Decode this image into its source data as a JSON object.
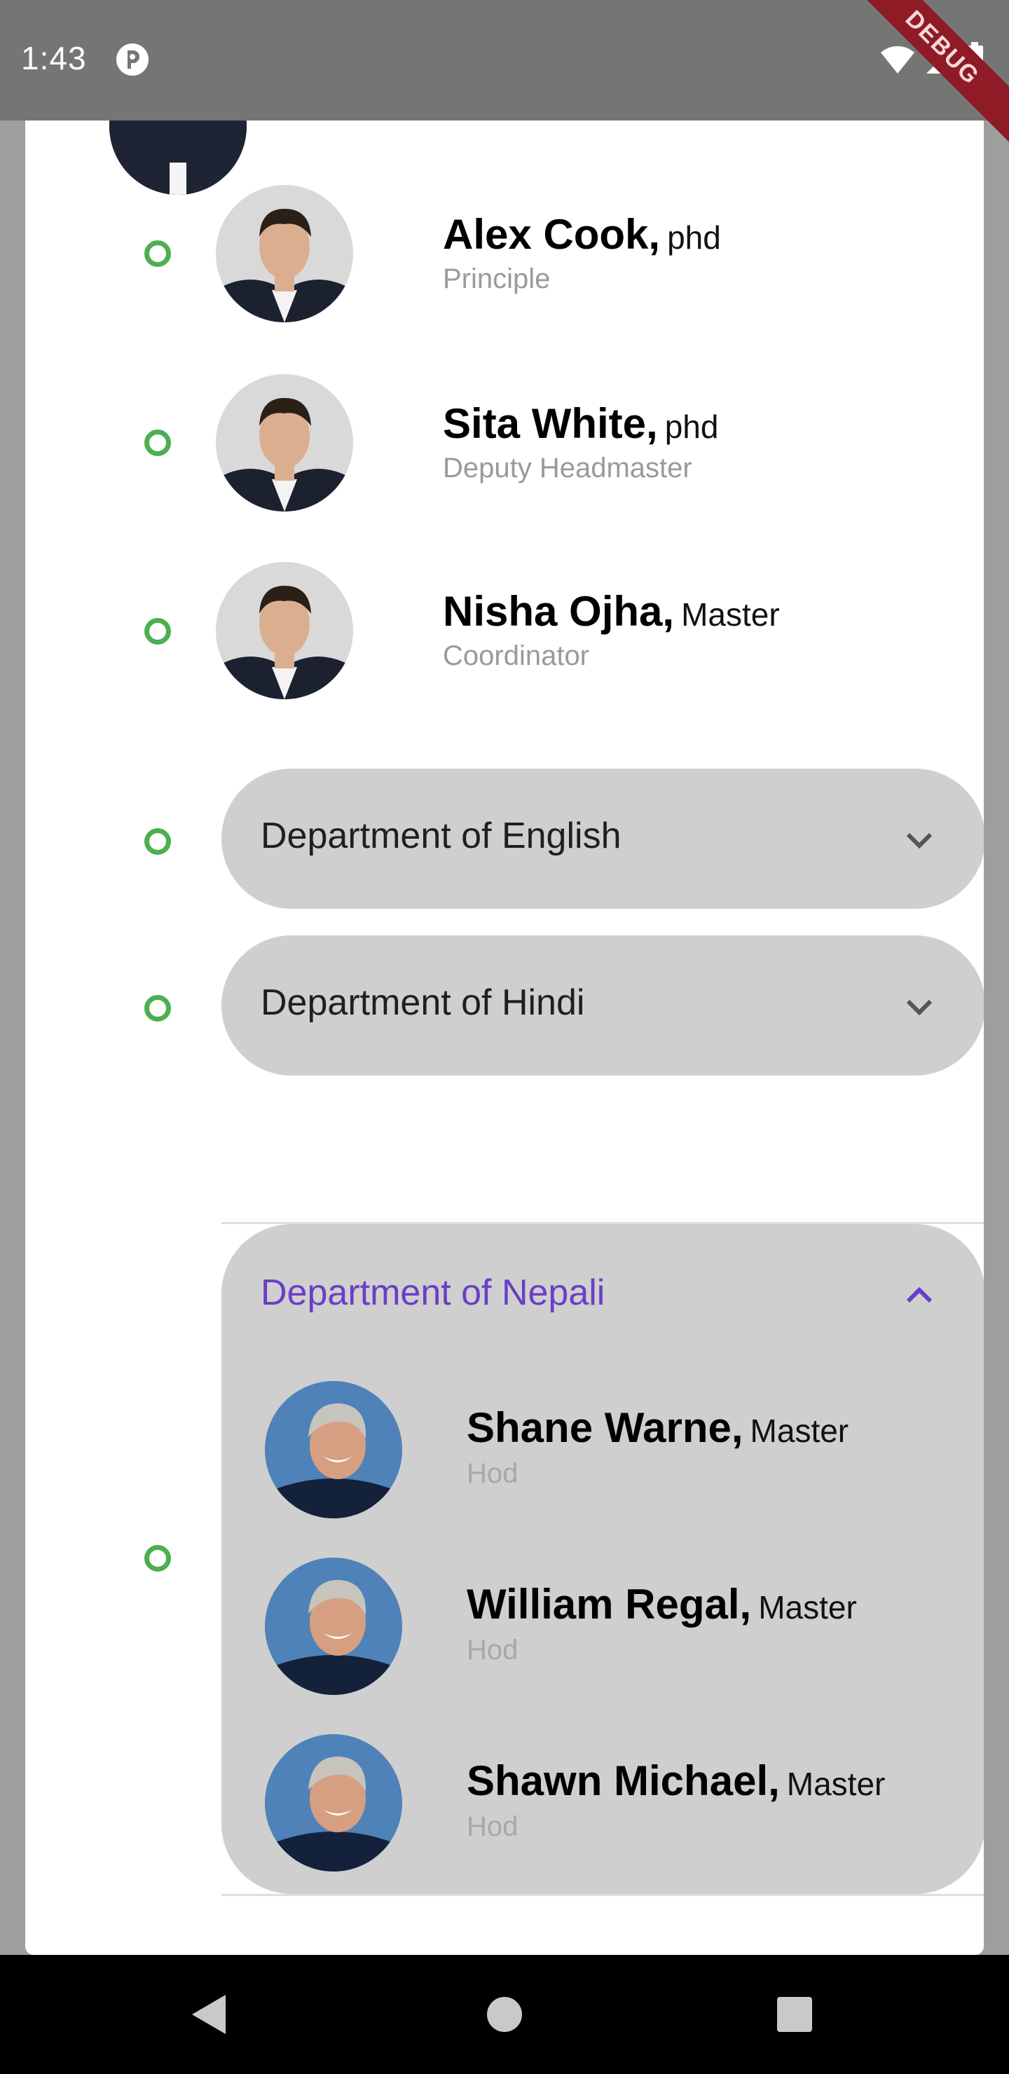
{
  "status_bar": {
    "time": "1:43",
    "debug_label": "DEBUG"
  },
  "leaders": [
    {
      "name": "Alex Cook,",
      "degree": "phd",
      "role": "Principle"
    },
    {
      "name": "Sita White,",
      "degree": "phd",
      "role": "Deputy Headmaster"
    },
    {
      "name": "Nisha Ojha,",
      "degree": "Master",
      "role": "Coordinator"
    }
  ],
  "departments": [
    {
      "label": "Department of English",
      "expanded": false
    },
    {
      "label": "Department of Hindi",
      "expanded": false
    },
    {
      "label": "Department of Nepali",
      "expanded": true,
      "members": [
        {
          "name": "Shane Warne,",
          "degree": "Master",
          "role": "Hod"
        },
        {
          "name": "William Regal,",
          "degree": "Master",
          "role": "Hod"
        },
        {
          "name": "Shawn Michael,",
          "degree": "Master",
          "role": "Hod"
        }
      ]
    }
  ],
  "colors": {
    "accent": "#6a3ec7",
    "timeline_dot": "#4caf50",
    "pill_bg": "#cfcfcf"
  },
  "icons": {
    "collapsed": "chevron-down-icon",
    "expanded": "chevron-up-icon",
    "nav": [
      "back-icon",
      "home-icon",
      "recents-icon"
    ]
  }
}
